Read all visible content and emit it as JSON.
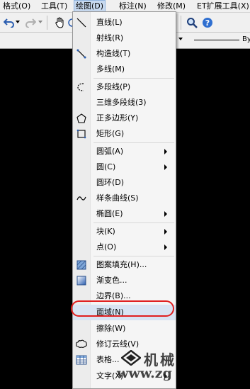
{
  "menubar": {
    "items": [
      {
        "label": "格式(O)"
      },
      {
        "label": "工具(T)"
      },
      {
        "label": "绘图(D)"
      },
      {
        "label": "标注(N)"
      },
      {
        "label": "修改(M)"
      },
      {
        "label": "ET扩展工具(X)"
      }
    ]
  },
  "toolbar": {
    "lineweight_label": "By"
  },
  "draw_menu": {
    "items": [
      {
        "label": "直线(L)",
        "icon": "line-icon"
      },
      {
        "label": "射线(R)"
      },
      {
        "label": "构造线(T)",
        "icon": "construction-line-icon"
      },
      {
        "label": "多线(M)"
      },
      {
        "label": "多段线(P)",
        "icon": "polyline-icon"
      },
      {
        "label": "三维多段线(3)"
      },
      {
        "label": "正多边形(Y)",
        "icon": "polygon-icon"
      },
      {
        "label": "矩形(G)",
        "icon": "rectangle-icon"
      },
      {
        "label": "圆弧(A)",
        "submenu": true
      },
      {
        "label": "圆(C)",
        "submenu": true
      },
      {
        "label": "圆环(D)"
      },
      {
        "label": "样条曲线(S)",
        "icon": "spline-icon"
      },
      {
        "label": "椭圆(E)",
        "submenu": true
      },
      {
        "label": "块(K)",
        "submenu": true
      },
      {
        "label": "点(O)",
        "submenu": true
      },
      {
        "label": "图案填充(H)...",
        "icon": "hatch-icon"
      },
      {
        "label": "渐变色...",
        "icon": "gradient-icon"
      },
      {
        "label": "边界(B)..."
      },
      {
        "label": "面域(N)",
        "highlighted": true
      },
      {
        "label": "擦除(W)"
      },
      {
        "label": "修订云线(V)",
        "icon": "revcloud-icon"
      },
      {
        "label": "表格...",
        "icon": "table-icon"
      },
      {
        "label": "文字(X)",
        "submenu": true
      }
    ]
  },
  "watermark": {
    "text": "机械",
    "url": "www.zg"
  },
  "colors": {
    "menu_bg": "#f5f5f5",
    "highlight": "#d8e4f3",
    "annotation_oval": "#e02020",
    "canvas": "#000000"
  }
}
